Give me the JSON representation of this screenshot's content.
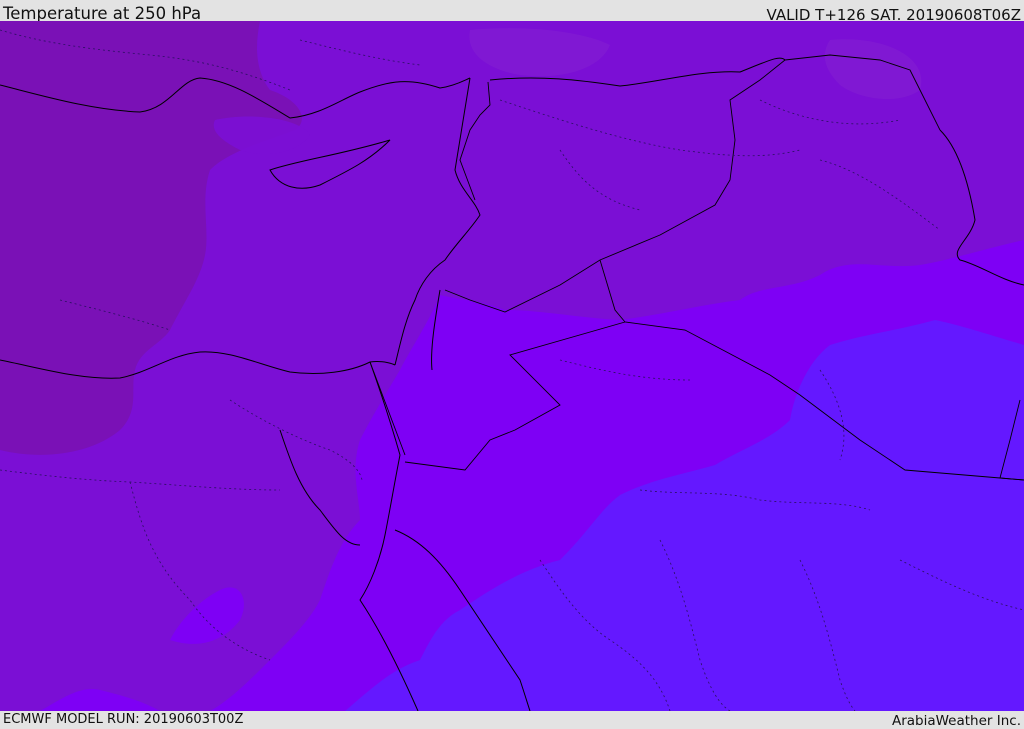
{
  "header": {
    "title": "Temperature at 250 hPa",
    "valid": "VALID T+126 SAT. 20190608T06Z"
  },
  "footer": {
    "model_run": "ECMWF MODEL RUN: 20190603T00Z",
    "credit": "ArabiaWeather Inc."
  },
  "map": {
    "field": "temperature-250hPa",
    "colors": {
      "cold_north": "#7a11b6",
      "mid_purple": "#7b0fd5",
      "mid_violet": "#7e00f5",
      "warm_south": "#6418ff",
      "coastline": "#000000",
      "border_dotted": "#2a1060"
    }
  }
}
